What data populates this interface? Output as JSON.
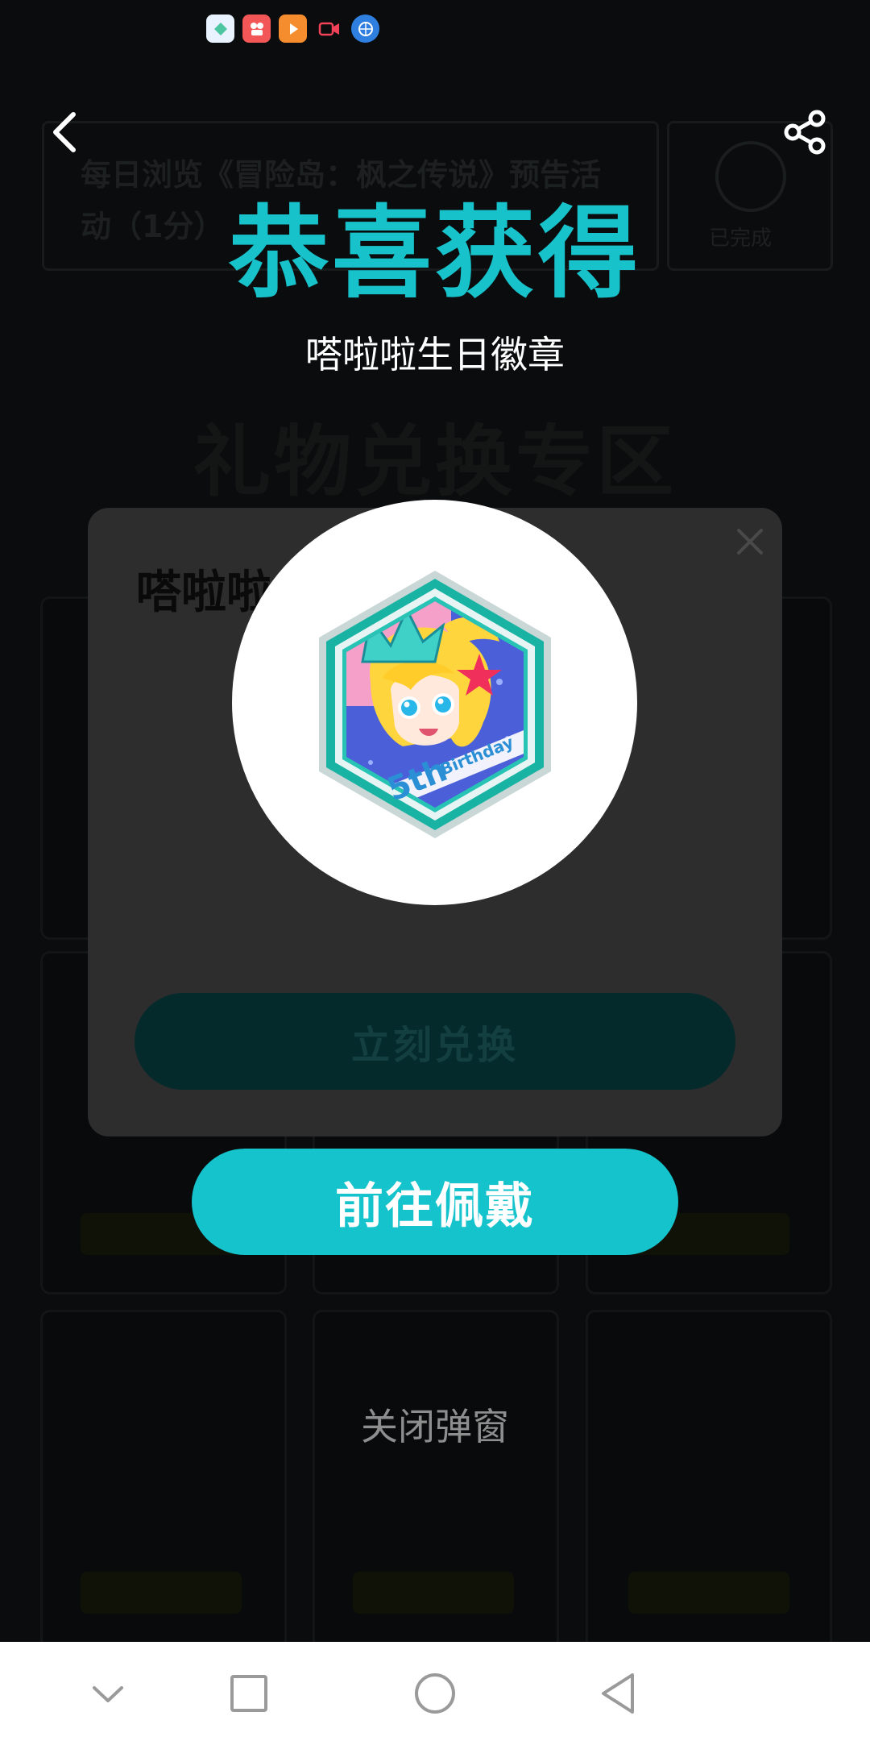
{
  "headline": "恭喜获得",
  "badge_name": "嗒啦啦生日徽章",
  "badge": {
    "text_number": "5th",
    "text_word": "Birthday"
  },
  "dialog": {
    "title": "嗒啦啦",
    "button_label": "立刻兑换"
  },
  "primary_button": "前往佩戴",
  "close_link": "关闭弹窗",
  "background": {
    "task_text": "每日浏览《冒险岛：枫之传说》预告活动（1分）",
    "side_label": "已完成",
    "heading": "礼物兑换专区"
  },
  "colors": {
    "accent": "#17c2cb",
    "dialog_bg": "#2d2d2d"
  }
}
